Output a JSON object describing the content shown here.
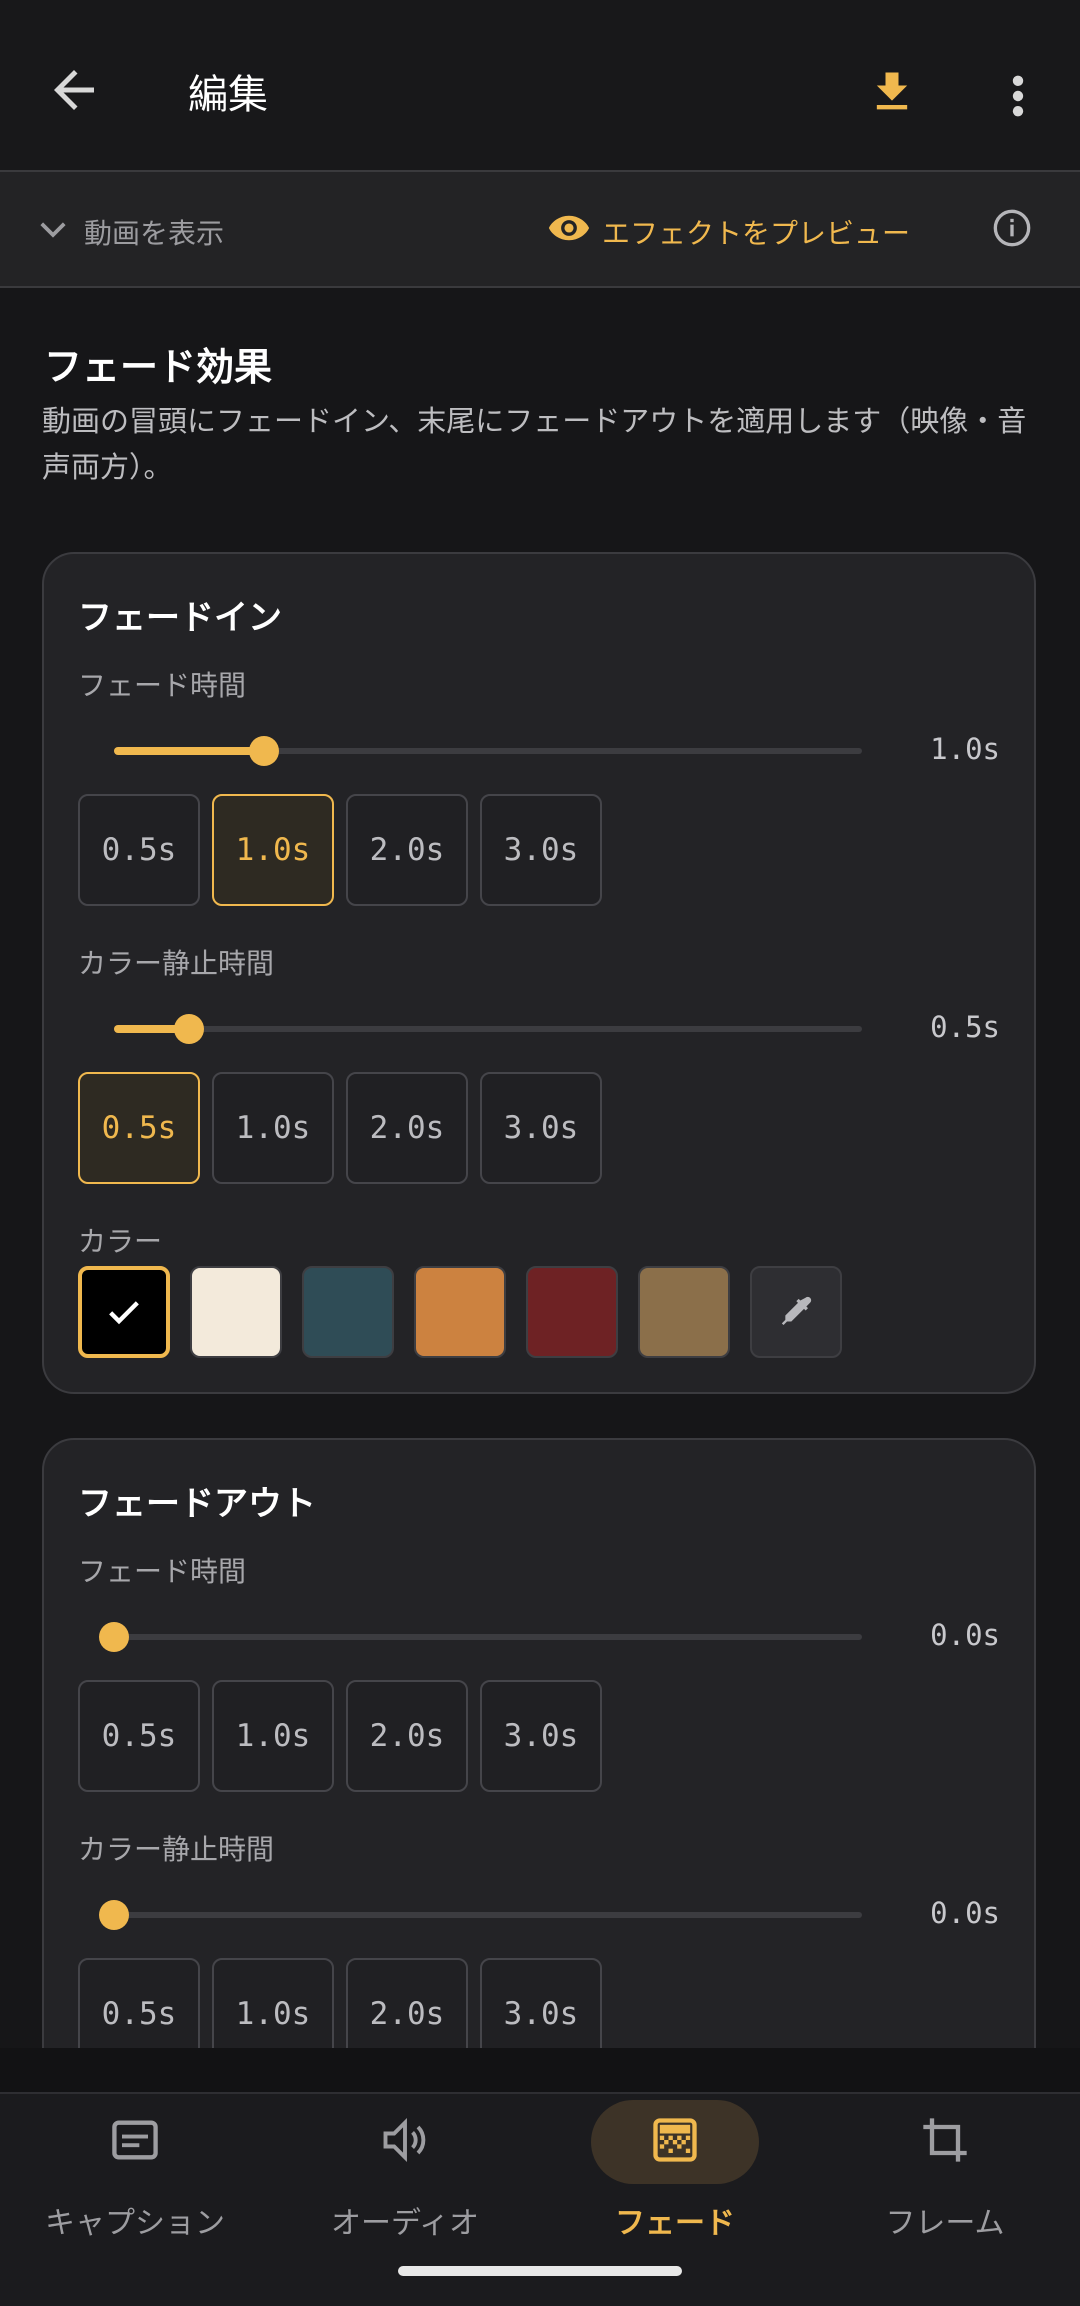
{
  "header": {
    "title": "編集"
  },
  "preview_bar": {
    "show_video_label": "動画を表示",
    "preview_effect_label": "エフェクトをプレビュー"
  },
  "section": {
    "title": "フェード効果",
    "description": "動画の冒頭にフェードイン、末尾にフェードアウトを適用します（映像・音声両方）。"
  },
  "fade_in": {
    "title": "フェードイン",
    "duration": {
      "label": "フェード時間",
      "value": "1.0s",
      "fraction": 0.2
    },
    "duration_options": [
      "0.5s",
      "1.0s",
      "2.0s",
      "3.0s"
    ],
    "duration_selected": 1,
    "hold": {
      "label": "カラー静止時間",
      "value": "0.5s",
      "fraction": 0.1
    },
    "hold_options": [
      "0.5s",
      "1.0s",
      "2.0s",
      "3.0s"
    ],
    "hold_selected": 0,
    "color_label": "カラー",
    "colors": [
      "#000000",
      "#f3eadb",
      "#2f4c56",
      "#cc8240",
      "#6e2224",
      "#8b6f4a"
    ],
    "color_selected": 0
  },
  "fade_out": {
    "title": "フェードアウト",
    "duration": {
      "label": "フェード時間",
      "value": "0.0s",
      "fraction": 0.0
    },
    "duration_options": [
      "0.5s",
      "1.0s",
      "2.0s",
      "3.0s"
    ],
    "hold": {
      "label": "カラー静止時間",
      "value": "0.0s",
      "fraction": 0.0
    },
    "hold_options": [
      "0.5s",
      "1.0s",
      "2.0s",
      "3.0s"
    ]
  },
  "nav": {
    "items": [
      {
        "label": "キャプション",
        "icon": "caption-icon"
      },
      {
        "label": "オーディオ",
        "icon": "speaker-icon"
      },
      {
        "label": "フェード",
        "icon": "fade-icon",
        "active": true
      },
      {
        "label": "フレーム",
        "icon": "crop-icon"
      }
    ]
  },
  "colors": {
    "accent": "#f0b84e"
  }
}
